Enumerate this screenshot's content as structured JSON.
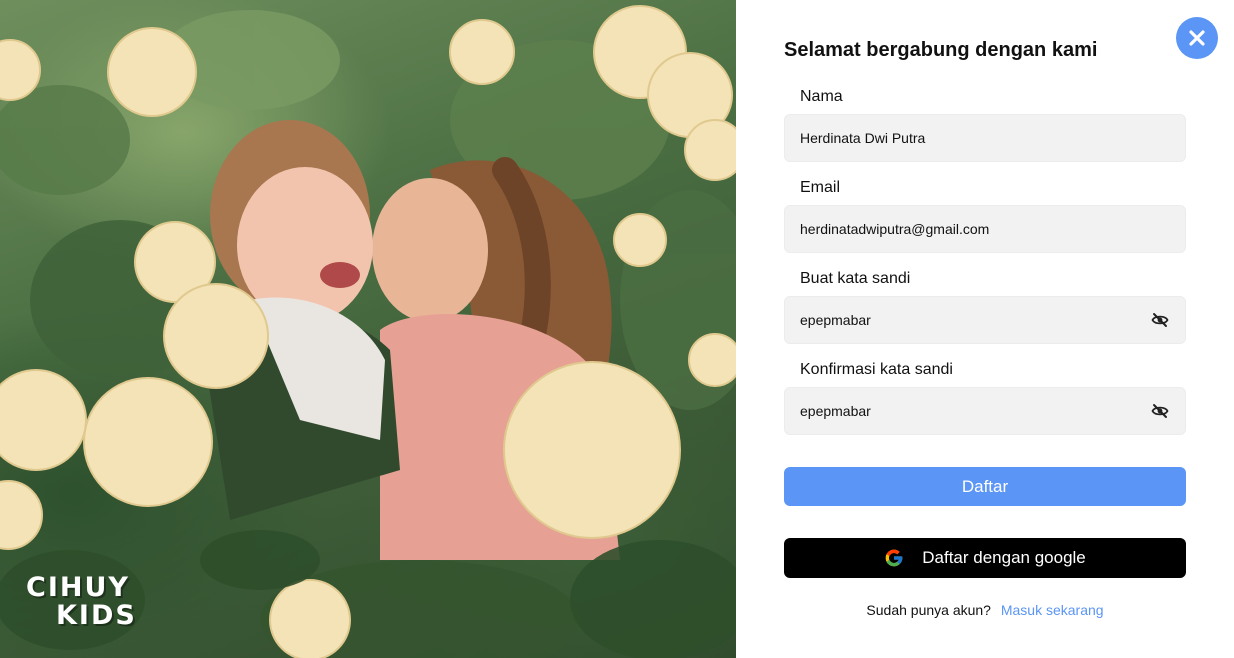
{
  "brand": {
    "logo_line1": "CIHUY",
    "logo_line2": "KIDS"
  },
  "form": {
    "title": "Selamat bergabung dengan kami",
    "name": {
      "label": "Nama",
      "value": "Herdinata Dwi Putra"
    },
    "email": {
      "label": "Email",
      "value": "herdinatadwiputra@gmail.com"
    },
    "password": {
      "label": "Buat kata sandi",
      "value": "epepmabar",
      "icon": "eye-off-icon"
    },
    "confirm_password": {
      "label": "Konfirmasi kata sandi",
      "value": "epepmabar",
      "icon": "eye-off-icon"
    },
    "submit_label": "Daftar",
    "google_label": "Daftar dengan google",
    "footer_text": "Sudah punya akun?",
    "footer_link": "Masuk sekarang"
  },
  "colors": {
    "accent": "#5b95f5",
    "google_button": "#000000",
    "field_bg": "#f2f2f2"
  }
}
